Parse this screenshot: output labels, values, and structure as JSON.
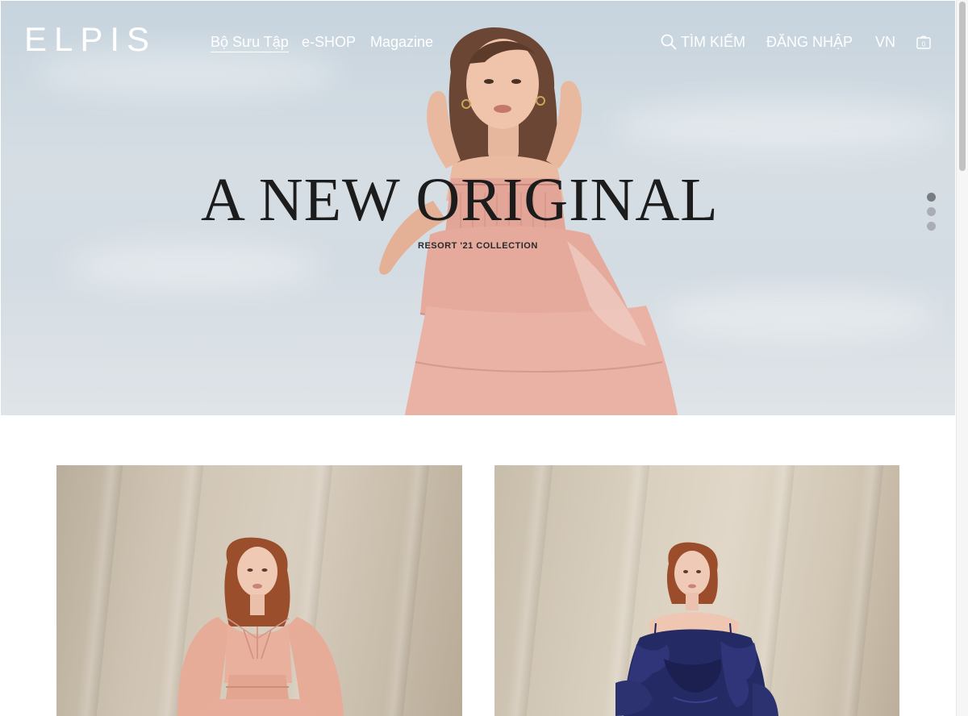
{
  "brand": {
    "logo_text": "ELPIS"
  },
  "nav": {
    "links": [
      {
        "label": "Bộ Sưu Tập",
        "active": true
      },
      {
        "label": "e-SHOP",
        "active": false
      },
      {
        "label": "Magazine",
        "active": false
      }
    ],
    "search_label": "TÌM KIẾM",
    "login_label": "ĐĂNG NHẬP",
    "language_label": "VN",
    "cart_count": "0"
  },
  "hero": {
    "title": "A NEW ORIGINAL",
    "subtitle": "RESORT '21 COLLECTION",
    "slides": [
      {
        "index": 1,
        "active": true
      },
      {
        "index": 2,
        "active": false
      },
      {
        "index": 3,
        "active": false
      }
    ]
  },
  "collection": {
    "cards": [
      {
        "name": "look-pink-dress",
        "dress_color": "#e6ac98"
      },
      {
        "name": "look-navy-ruffle",
        "dress_color": "#242a63"
      }
    ]
  },
  "colors": {
    "nav_text": "#ffffff",
    "hero_title": "#1c1c1c",
    "dot_active": "#777d82",
    "dot_inactive": "#a8aeb3"
  },
  "icons": {
    "search": "search-icon",
    "cart": "shopping-bag-icon"
  }
}
